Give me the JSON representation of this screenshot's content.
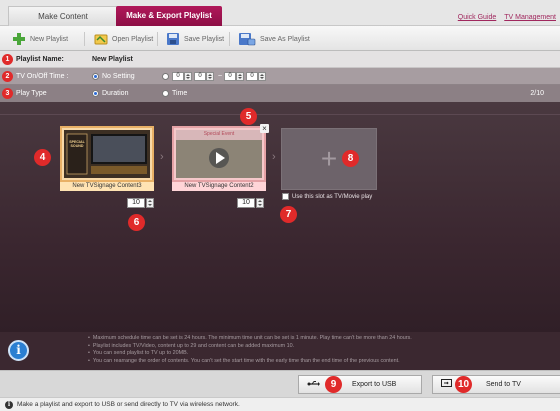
{
  "tabs": {
    "inactive": "Make Content",
    "active": "Make & Export Playlist"
  },
  "top_links": {
    "quick_guide": "Quick Guide",
    "tv_management": "TV Management"
  },
  "toolbar": {
    "new_playlist": "New Playlist",
    "open_playlist": "Open Playlist",
    "save_playlist": "Save Playlist",
    "save_as_playlist": "Save As Playlist"
  },
  "settings": {
    "playlist_name_label": "Playlist Name:",
    "playlist_name_value": "New Playlist",
    "tv_onoff_label": "TV On/Off Time :",
    "no_setting": "No Setting",
    "time_values": [
      "0",
      "0",
      "0",
      "0"
    ],
    "time_separator": "~",
    "play_type_label": "Play Type",
    "duration": "Duration",
    "time": "Time",
    "count": "2/10"
  },
  "slots": [
    {
      "caption": "New TVSignage Content3",
      "duration": "10",
      "thumb_title": "SPECIAL SOUND"
    },
    {
      "caption": "New TVSignage Content2",
      "duration": "10",
      "thumb_title": "Special Event"
    }
  ],
  "use_tv_slot": "Use this slot as TV/Movie play",
  "markers": [
    "1",
    "2",
    "3",
    "4",
    "5",
    "6",
    "7",
    "8",
    "9",
    "10"
  ],
  "info_lines": [
    "Maximum schedule time can be set is 24 hours. The minimum time unit can be set is 1 minute. Play time can't be more than 24 hours.",
    "Playlist includes TV/Video, content up to 29 and content can be added maximum 10.",
    "You can send playlist to TV up to 20MB.",
    "You can rearrange the order of contents. You can't set the start time with the early time than the end time of the previous content."
  ],
  "buttons": {
    "export_usb": "Export to USB",
    "send_tv": "Send to TV"
  },
  "status": "Make a playlist and export to USB or send directly to TV via wireless network.",
  "colors": {
    "accent": "#a0185a",
    "marker": "#e02a2a",
    "info_blue": "#2b7fd1"
  }
}
